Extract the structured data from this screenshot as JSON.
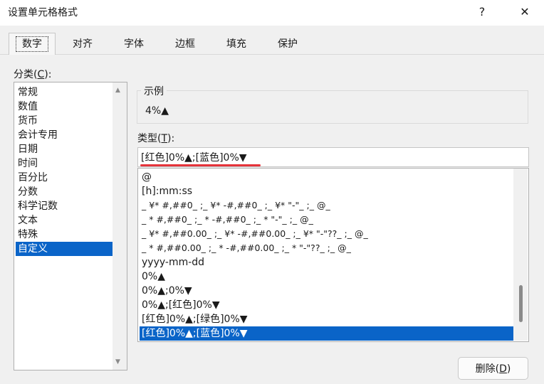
{
  "window": {
    "title": "设置单元格格式",
    "help": "?",
    "close": "✕"
  },
  "tabs": [
    {
      "label": "数字",
      "active": true
    },
    {
      "label": "对齐"
    },
    {
      "label": "字体"
    },
    {
      "label": "边框"
    },
    {
      "label": "填充"
    },
    {
      "label": "保护"
    }
  ],
  "category": {
    "label_text": "分类(",
    "label_key": "C",
    "label_end": "):",
    "items": [
      "常规",
      "数值",
      "货币",
      "会计专用",
      "日期",
      "时间",
      "百分比",
      "分数",
      "科学记数",
      "文本",
      "特殊",
      "自定义"
    ],
    "selected": "自定义"
  },
  "sample": {
    "label": "示例",
    "value": "4%▲"
  },
  "type": {
    "label_text": "类型(",
    "label_key": "T",
    "label_end": "):",
    "value": "[红色]0%▲;[蓝色]0%▼"
  },
  "formats": [
    "@",
    "[h]:mm:ss",
    "_ ¥* #,##0_ ;_ ¥* -#,##0_ ;_ ¥* \"-\"_ ;_ @_",
    "_ * #,##0_ ;_ * -#,##0_ ;_ * \"-\"_ ;_ @_",
    "_ ¥* #,##0.00_ ;_ ¥* -#,##0.00_ ;_ ¥* \"-\"??_ ;_ @_",
    "_ * #,##0.00_ ;_ * -#,##0.00_ ;_ * \"-\"??_ ;_ @_",
    "yyyy-mm-dd",
    "0%▲",
    "0%▲;0%▼",
    "0%▲;[红色]0%▼",
    "[红色]0%▲;[绿色]0%▼",
    "[红色]0%▲;[蓝色]0%▼"
  ],
  "delete_button": {
    "text": "删除(",
    "key": "D",
    "end": ")"
  },
  "colors": {
    "selection": "#0a64c8",
    "annotation_underline": "#e5333a"
  }
}
